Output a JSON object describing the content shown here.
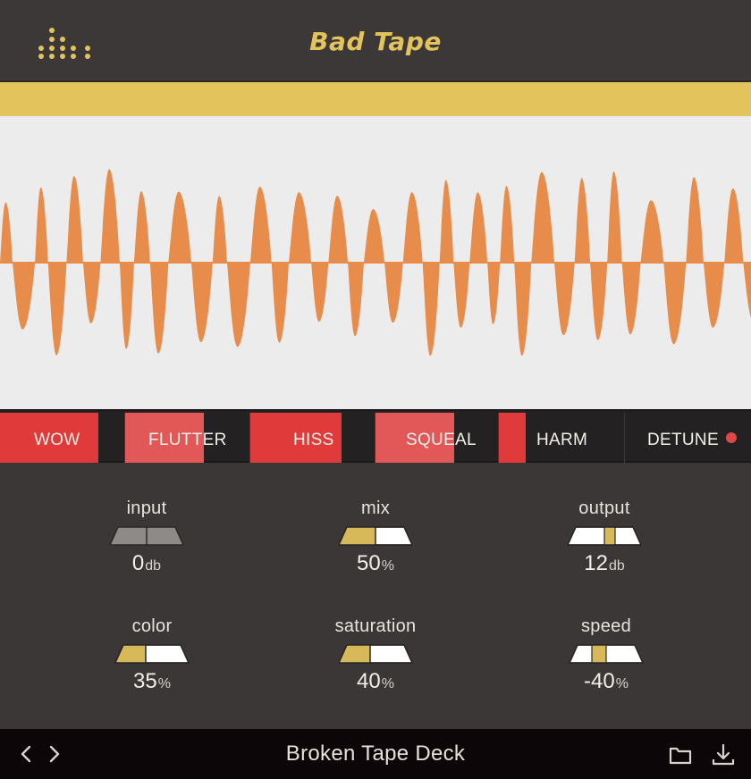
{
  "header": {
    "title": "Bad Tape",
    "logo_icon": "dot-grid-logo-icon"
  },
  "colors": {
    "accent_yellow": "#e3c45c",
    "waveform_orange": "#e88c4c",
    "fx_red": "#e03a3a",
    "fx_pink": "#e25858",
    "panel_dark": "#3a3736",
    "footer_bg": "#0c0608"
  },
  "effects": [
    {
      "label": "WOW",
      "level": 1.0
    },
    {
      "label": "FLUTTER",
      "level": 0.63
    },
    {
      "label": "HISS",
      "level": 0.73
    },
    {
      "label": "SQUEAL",
      "level": 0.63
    },
    {
      "label": "HARM",
      "level": 0.2
    },
    {
      "label": "DETUNE",
      "level": 0.0,
      "active_indicator": true
    }
  ],
  "controls": [
    {
      "label": "input",
      "value": "0",
      "unit": "db",
      "fill_fraction": 0.5,
      "style": "neutral"
    },
    {
      "label": "mix",
      "value": "50",
      "unit": "%",
      "fill_fraction": 0.5,
      "style": "left"
    },
    {
      "label": "output",
      "value": "12",
      "unit": "db",
      "fill_fraction": 0.6,
      "style": "center"
    },
    {
      "label": "color",
      "value": "35",
      "unit": "%",
      "fill_fraction": 0.4,
      "style": "left"
    },
    {
      "label": "saturation",
      "value": "40",
      "unit": "%",
      "fill_fraction": 0.43,
      "style": "left"
    },
    {
      "label": "speed",
      "value": "-40",
      "unit": "%",
      "fill_fraction": -0.4,
      "style": "center"
    }
  ],
  "footer": {
    "preset_name": "Broken Tape Deck",
    "prev_icon": "chevron-left-icon",
    "next_icon": "chevron-right-icon",
    "folder_icon": "folder-icon",
    "download_icon": "download-icon"
  }
}
